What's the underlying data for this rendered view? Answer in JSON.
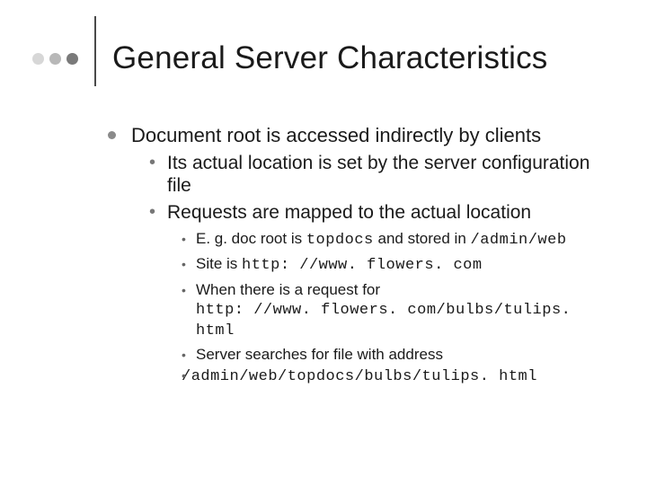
{
  "title": "General Server Characteristics",
  "bullets": {
    "l1": "Document root is accessed indirectly by clients",
    "l2a": "Its actual location is set by the server configuration file",
    "l2b": "Requests are mapped to the actual location",
    "l3a_pre": "E. g. doc root is ",
    "l3a_code1": "topdocs",
    "l3a_mid": " and stored in ",
    "l3a_code2": "/admin/web",
    "l3b_pre": "Site is ",
    "l3b_code": "http: //www. flowers. com",
    "l3c_pre": "When there is a request for ",
    "l3c_code": "http: //www. flowers. com/bulbs/tulips. html",
    "l3d_pre": "Server searches for file with address",
    "l3d_code": "/admin/web/topdocs/bulbs/tulips. html"
  }
}
